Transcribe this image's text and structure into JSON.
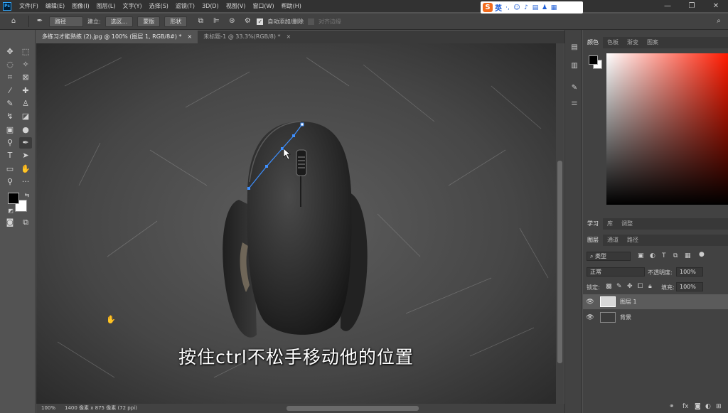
{
  "menubar": {
    "items": [
      "文件(F)",
      "编辑(E)",
      "图像(I)",
      "图层(L)",
      "文字(Y)",
      "选择(S)",
      "滤镜(T)",
      "3D(D)",
      "视图(V)",
      "窗口(W)",
      "帮助(H)"
    ],
    "app_logo": "Ps"
  },
  "ime": {
    "logo": "S",
    "lang": "英"
  },
  "options": {
    "mode": "路径",
    "build_label": "建立:",
    "selection_btn": "选区...",
    "mask_btn": "蒙版",
    "shape_btn": "形状",
    "auto_add_label": "自动添加/删除",
    "align_edges_label": "对齐边缘"
  },
  "tabs": [
    {
      "label": "多练习才能熟练 (2).jpg @ 100% (图层 1, RGB/8#) *",
      "close": "×"
    },
    {
      "label": "未标题-1 @ 33.3%(RGB/8) *",
      "close": "×"
    }
  ],
  "canvas": {
    "caption": "按住ctrl不松手移动他的位置"
  },
  "status": {
    "zoom": "100%",
    "doc_info": "1400 像素 x 875 像素 (72 ppi)"
  },
  "color_panel": {
    "tabs": [
      "颜色",
      "色板",
      "渐变",
      "图案"
    ]
  },
  "learn_panel": {
    "tabs": [
      "学习",
      "库",
      "调整"
    ]
  },
  "layers_panel": {
    "tabs": [
      "图层",
      "通道",
      "路径"
    ],
    "filter_kind": "类型",
    "blend_mode": "正常",
    "opacity_label": "不透明度:",
    "opacity_value": "100%",
    "lock_label": "锁定:",
    "fill_label": "填充:",
    "fill_value": "100%",
    "layers": [
      {
        "name": "图层 1",
        "selected": true
      },
      {
        "name": "背景",
        "selected": false
      }
    ]
  },
  "colors": {
    "accent": "#31a8ff",
    "bg_panel": "#424242",
    "canvas_bg": "#535353"
  }
}
